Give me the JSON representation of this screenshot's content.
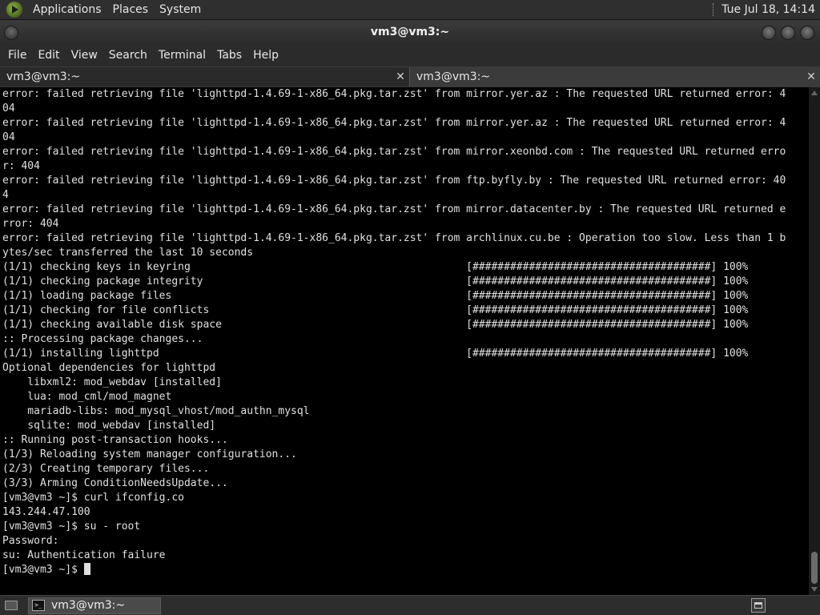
{
  "top_panel": {
    "menus": [
      "Applications",
      "Places",
      "System"
    ],
    "clock": "Tue Jul 18, 14:14"
  },
  "window": {
    "title": "vm3@vm3:~",
    "menu": [
      "File",
      "Edit",
      "View",
      "Search",
      "Terminal",
      "Tabs",
      "Help"
    ],
    "tabs": [
      {
        "label": "vm3@vm3:~",
        "close": "✕"
      },
      {
        "label": "vm3@vm3:~",
        "close": "✕"
      }
    ]
  },
  "terminal": {
    "lines": [
      "error: failed retrieving file 'lighttpd-1.4.69-1-x86_64.pkg.tar.zst' from mirror.yer.az : The requested URL returned error: 4",
      "04",
      "error: failed retrieving file 'lighttpd-1.4.69-1-x86_64.pkg.tar.zst' from mirror.yer.az : The requested URL returned error: 4",
      "04",
      "error: failed retrieving file 'lighttpd-1.4.69-1-x86_64.pkg.tar.zst' from mirror.xeonbd.com : The requested URL returned erro",
      "r: 404",
      "error: failed retrieving file 'lighttpd-1.4.69-1-x86_64.pkg.tar.zst' from ftp.byfly.by : The requested URL returned error: 40",
      "4",
      "error: failed retrieving file 'lighttpd-1.4.69-1-x86_64.pkg.tar.zst' from mirror.datacenter.by : The requested URL returned e",
      "rror: 404",
      "error: failed retrieving file 'lighttpd-1.4.69-1-x86_64.pkg.tar.zst' from archlinux.cu.be : Operation too slow. Less than 1 b",
      "ytes/sec transferred the last 10 seconds",
      "(1/1) checking keys in keyring                                            [######################################] 100%",
      "(1/1) checking package integrity                                          [######################################] 100%",
      "(1/1) loading package files                                               [######################################] 100%",
      "(1/1) checking for file conflicts                                         [######################################] 100%",
      "(1/1) checking available disk space                                       [######################################] 100%",
      ":: Processing package changes...",
      "(1/1) installing lighttpd                                                 [######################################] 100%",
      "Optional dependencies for lighttpd",
      "    libxml2: mod_webdav [installed]",
      "    lua: mod_cml/mod_magnet",
      "    mariadb-libs: mod_mysql_vhost/mod_authn_mysql",
      "    sqlite: mod_webdav [installed]",
      ":: Running post-transaction hooks...",
      "(1/3) Reloading system manager configuration...",
      "(2/3) Creating temporary files...",
      "(3/3) Arming ConditionNeedsUpdate...",
      "[vm3@vm3 ~]$ curl ifconfig.co",
      "143.244.47.100",
      "[vm3@vm3 ~]$ su - root",
      "Password:",
      "su: Authentication failure",
      "[vm3@vm3 ~]$ "
    ]
  },
  "taskbar": {
    "task_label": "vm3@vm3:~"
  }
}
